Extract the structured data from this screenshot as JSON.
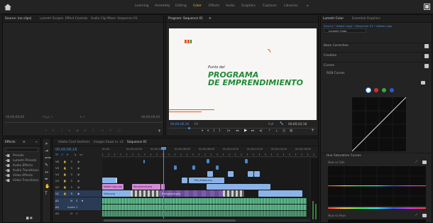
{
  "workspaces": [
    {
      "label": "Learning",
      "active": false
    },
    {
      "label": "Assembly",
      "active": false
    },
    {
      "label": "Editing",
      "active": false
    },
    {
      "label": "Color",
      "active": true
    },
    {
      "label": "Effects",
      "active": false
    },
    {
      "label": "Audio",
      "active": false
    },
    {
      "label": "Graphics",
      "active": false
    },
    {
      "label": "Captions",
      "active": false
    },
    {
      "label": "Libraries",
      "active": false
    }
  ],
  "source_panel": {
    "tabs": [
      "Source: (no clips)",
      "Lumetri Scopes",
      "Effect Controls",
      "Audio Clip Mixer: Sequence 01"
    ],
    "timecode_left": "00;00;00;00",
    "page_label": "Page 1",
    "timecode_right": "00;00;00;00"
  },
  "program_panel": {
    "title": "Program: Sequence 01",
    "video_line1": "Punto del",
    "video_line2": "PROGRAMA",
    "video_line3": "DE EMPRENDIMIENTO",
    "timecode": "00;00;06;16",
    "fit_label": "Fit",
    "quality": "Full",
    "duration": "00;00;02;18"
  },
  "lumetri": {
    "tabs": [
      "Lumetri Color",
      "Essential Graphics"
    ],
    "path": "Source • Adobe Logo • Sequence 01 • Adobe Logo",
    "effect": "Lumetri Color",
    "sections": [
      "Basic Correction",
      "Creative",
      "Curves"
    ],
    "subsection": "RGB Curves",
    "hue_section": "Hue Saturation Curves",
    "hue_vs_sat": "Hue vs Sat",
    "hue_vs_hue": "Hue vs Hue",
    "colors": {
      "curve_white": "#ffffff",
      "red": "#d23030",
      "green": "#2fae3a",
      "blue": "#2b5ad6"
    }
  },
  "effects_panel": {
    "title": "Effects",
    "items": [
      "Presets",
      "Lumetri Presets",
      "Audio Effects",
      "Audio Transitions",
      "Video Effects",
      "Video Transitions"
    ]
  },
  "timeline": {
    "tabs": [
      "Adobe Card Sections",
      "Images Sawe in: s3",
      "Sequence 01"
    ],
    "timecode": "00;00;06;16",
    "ruler": [
      "00;00",
      "00;00;02;00",
      "00;00;04;00",
      "00;00;06;00",
      "00;00;08;00",
      "00;00;10;00",
      "00;00;12;00",
      "00;00;14;00",
      "00;00;16;00"
    ],
    "tracks": [
      "V6",
      "V5",
      "V4",
      "V3",
      "V2",
      "V1",
      "A1",
      "A2",
      "A3"
    ],
    "clip_labels": {
      "v2a": "Adobe Logo.png",
      "v2b": "Background.png",
      "v1a": "Video.png",
      "v1b": "Background.png",
      "v3": "Title_Adobe.png"
    },
    "audio_master": "Audio 1"
  }
}
